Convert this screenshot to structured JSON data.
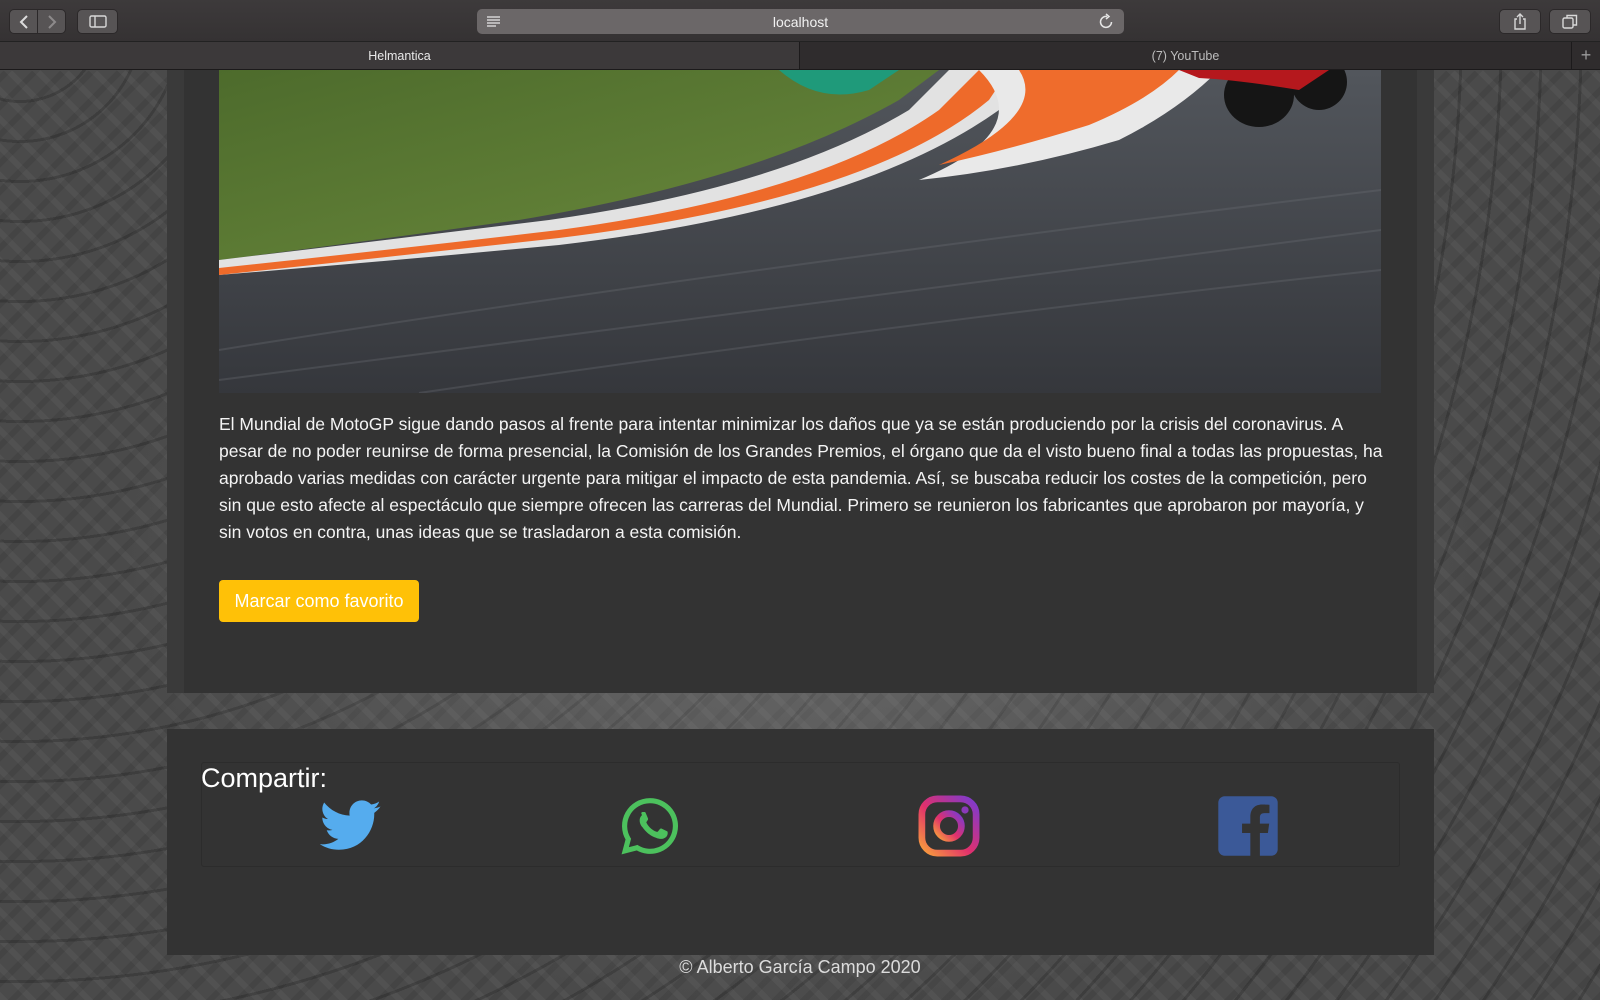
{
  "browser": {
    "url": "localhost",
    "tabs": [
      {
        "label": "Helmantica",
        "active": true
      },
      {
        "label": "(7) YouTube",
        "active": false
      }
    ],
    "icons": {
      "back": "chevron-left-icon",
      "forward": "chevron-right-icon",
      "sidebar": "sidebar-icon",
      "reader": "reader-icon",
      "reload": "reload-icon",
      "share": "share-icon",
      "tabs": "tab-overview-icon",
      "new_tab": "plus-icon"
    }
  },
  "article": {
    "image_alt": "Motorcycle on racetrack curve",
    "body": "El Mundial de MotoGP sigue dando pasos al frente para intentar minimizar los daños que ya se están produciendo por la crisis del coronavirus. A pesar de no poder reunirse de forma presencial, la Comisión de los Grandes Premios, el órgano que da el visto bueno final a todas las propuestas, ha aprobado varias medidas con carácter urgente para mitigar el impacto de esta pandemia. Así, se buscaba reducir los costes de la competición, pero sin que esto afecte al espectáculo que siempre ofrecen las carreras del Mundial. Primero se reunieron los fabricantes que aprobaron por mayoría, y sin votos en contra, unas ideas que se trasladaron a esta comisión.",
    "favorite_label": "Marcar como favorito"
  },
  "share": {
    "title": "Compartir:",
    "networks": [
      {
        "name": "twitter",
        "icon": "twitter-icon",
        "color": "#55acee"
      },
      {
        "name": "whatsapp",
        "icon": "whatsapp-icon",
        "color": "#4cc15d"
      },
      {
        "name": "instagram",
        "icon": "instagram-icon",
        "color": "#c13584"
      },
      {
        "name": "facebook",
        "icon": "facebook-icon",
        "color": "#3b5998"
      }
    ]
  },
  "footer": {
    "copyright": "© Alberto García Campo 2020"
  },
  "colors": {
    "accent": "#ffc107",
    "card": "#333333"
  }
}
